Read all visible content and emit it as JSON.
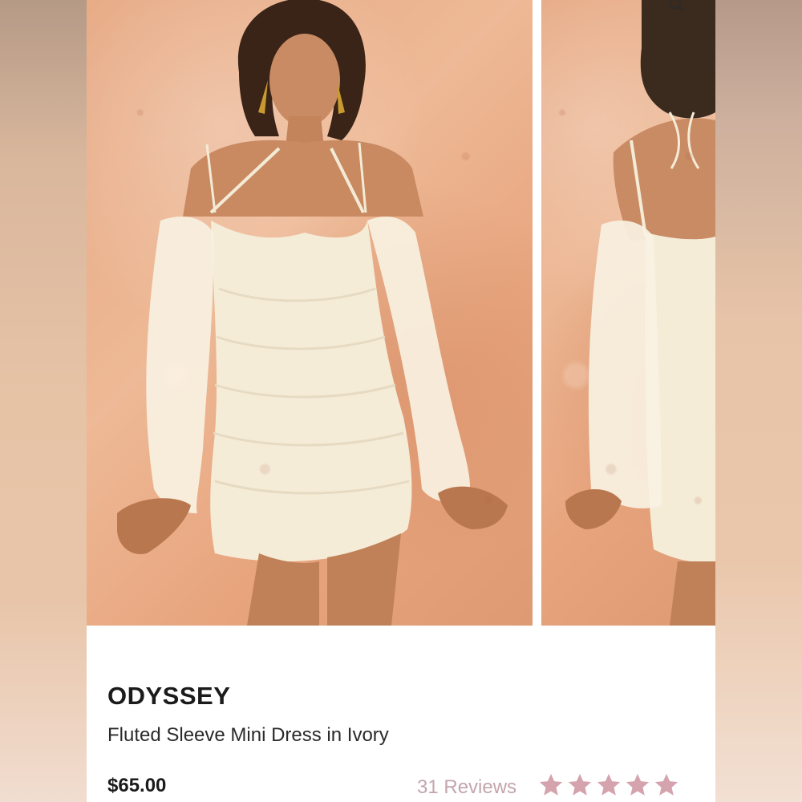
{
  "gallery": {
    "images": [
      {
        "name": "front-view-photo",
        "alt": ""
      },
      {
        "name": "back-view-photo",
        "alt": ""
      }
    ],
    "zoom_icon": "zoom-icon"
  },
  "product": {
    "brand": "ODYSSEY",
    "name": "Fluted Sleeve Mini Dress in Ivory",
    "price": "$65.00",
    "reviews_label": "31 Reviews",
    "rating": 5,
    "rating_max": 5
  },
  "colors": {
    "star": "#d4a3ad",
    "text": "#1b1b1b",
    "muted": "#c3a5ad"
  }
}
